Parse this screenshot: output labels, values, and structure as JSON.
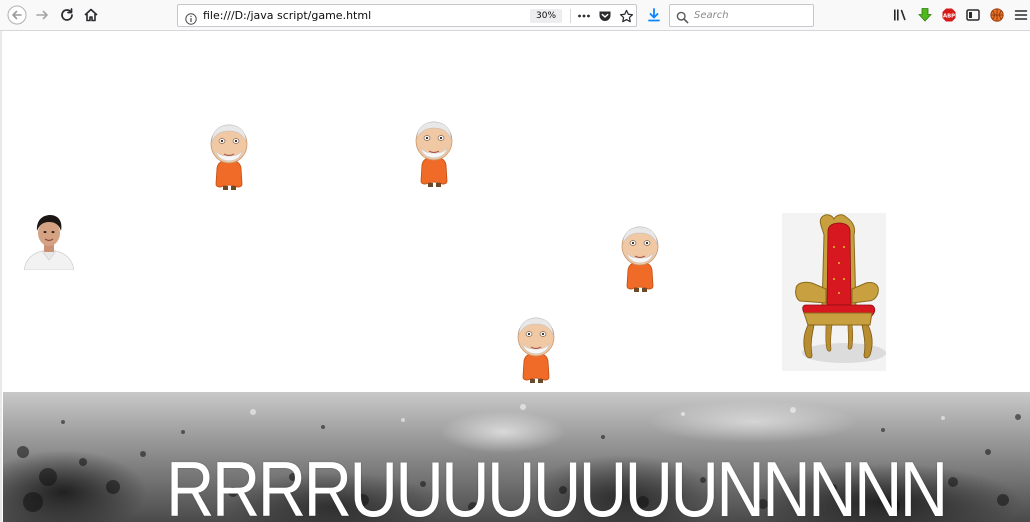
{
  "browser": {
    "url": "file:///D:/java script/game.html",
    "zoom": "30%",
    "search_placeholder": "Search"
  },
  "icons": {
    "back": "back-arrow-icon",
    "forward": "forward-arrow-icon",
    "reload": "reload-icon",
    "home": "home-icon",
    "info": "info-icon",
    "page_actions": "more-dots-icon",
    "pocket": "pocket-icon",
    "bookmark": "star-icon",
    "downloads": "download-arrow-icon",
    "library": "library-icon",
    "addon_download": "green-download-icon",
    "adblock": "abp-icon",
    "sidebar": "sidebar-icon",
    "addon_ball": "basketball-icon",
    "menu": "hamburger-menu-icon"
  },
  "game": {
    "player": "player-character",
    "enemy": "enemy-head-sprite",
    "enemy_count": 4,
    "goal": "golden-throne-chair",
    "ground_text": "RRRRUUUUUUUUNNNNN"
  },
  "colors": {
    "toolbar_bg": "#f9f9fa",
    "download_blue": "#0a84ff",
    "ground_dark": "#4a4a4a",
    "throne_red": "#d81820",
    "throne_gold": "#c9a040"
  }
}
